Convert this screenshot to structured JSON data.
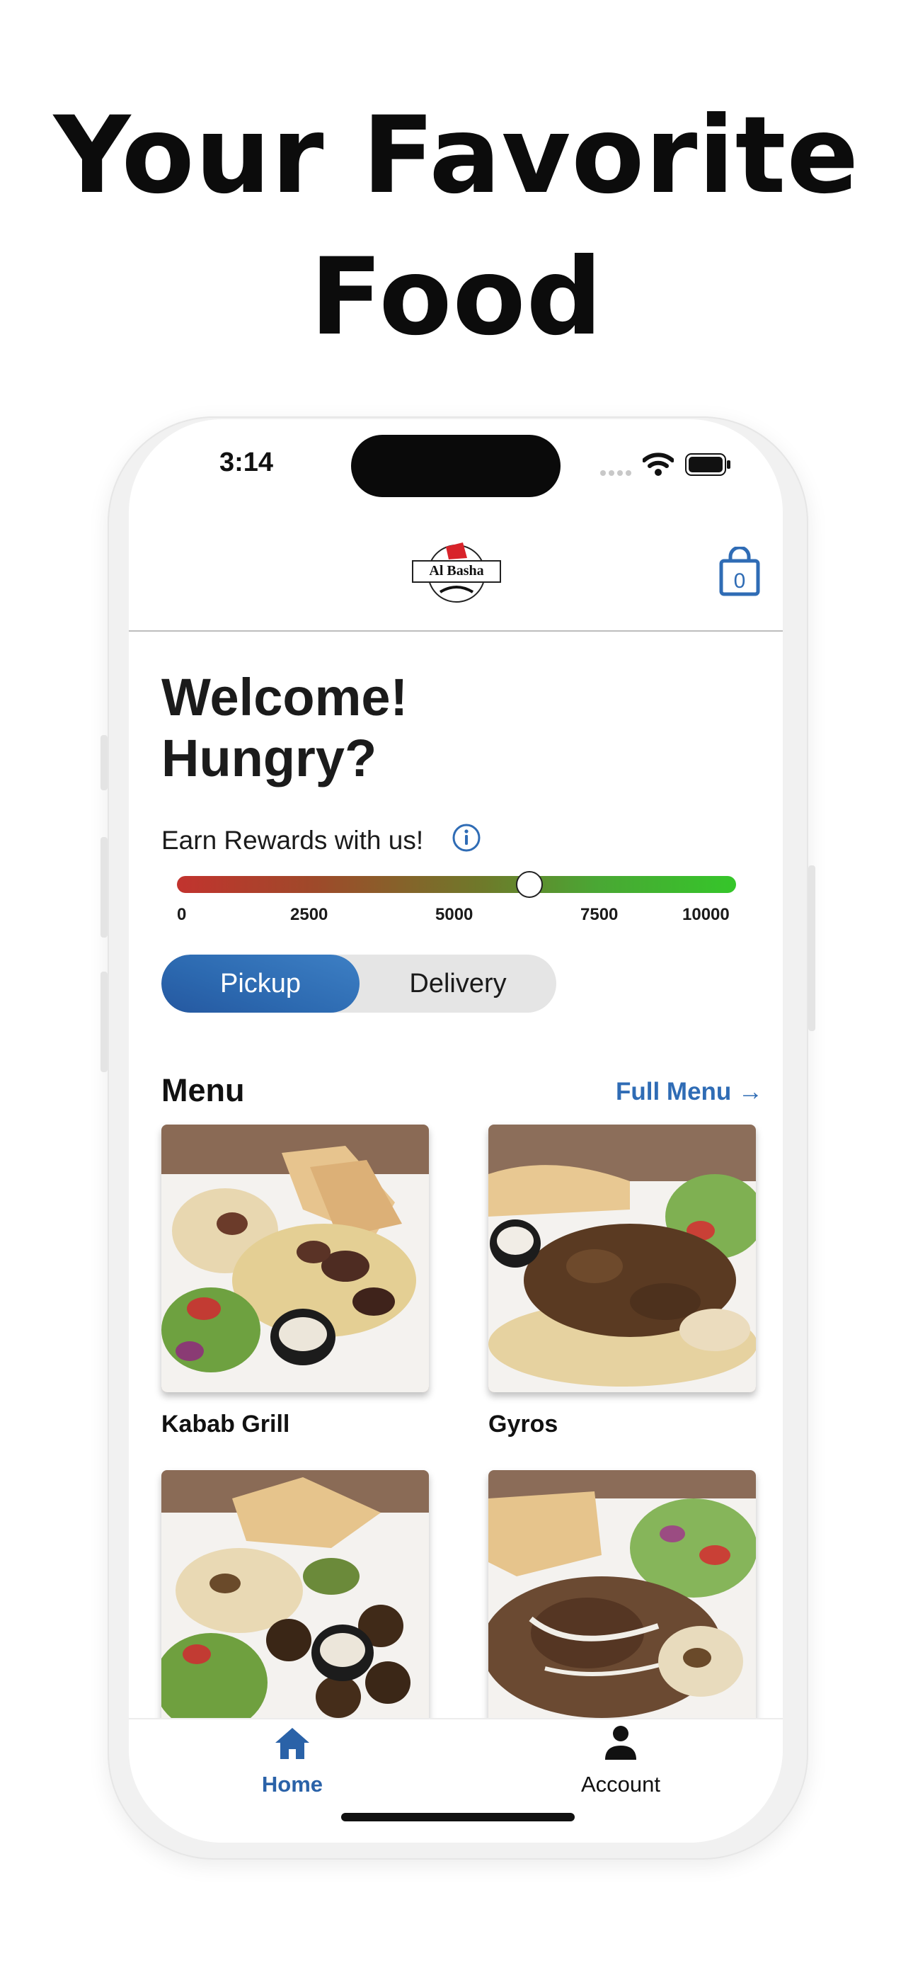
{
  "headline": {
    "line1": "Your Favorite",
    "line2": "Food"
  },
  "status_bar": {
    "time": "3:14"
  },
  "header": {
    "logo_text": "Al Basha",
    "cart_count": "0"
  },
  "welcome": {
    "line1": "Welcome!",
    "line2": "Hungry?"
  },
  "rewards": {
    "label": "Earn Rewards with us!",
    "ticks": [
      "0",
      "2500",
      "5000",
      "7500",
      "10000"
    ],
    "slider_value": 6300,
    "slider_max": 10000
  },
  "order_mode": {
    "options": [
      "Pickup",
      "Delivery"
    ],
    "selected": "Pickup"
  },
  "menu": {
    "title": "Menu",
    "full_menu_link": "Full Menu →",
    "items": [
      {
        "label": "Kabab Grill"
      },
      {
        "label": "Gyros"
      },
      {
        "label": ""
      },
      {
        "label": ""
      }
    ]
  },
  "tabbar": {
    "home": "Home",
    "account": "Account",
    "selected": "Home"
  },
  "colors": {
    "accent": "#2f6cb5",
    "slider_start": "#c2332e",
    "slider_end": "#35c62a"
  }
}
